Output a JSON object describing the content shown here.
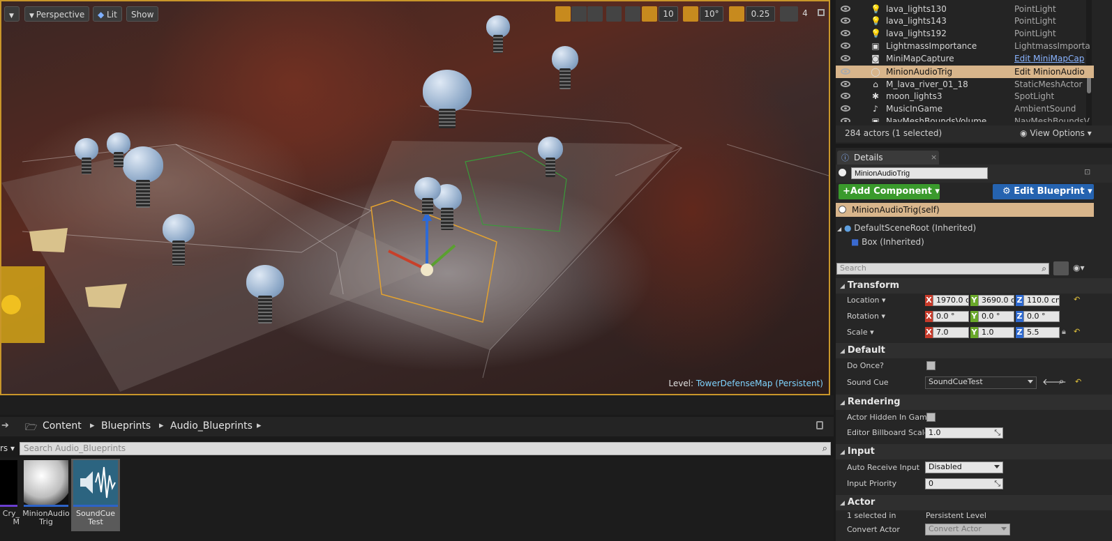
{
  "viewport": {
    "perspective_label": "Perspective",
    "lit_label": "Lit",
    "show_label": "Show",
    "grid_snap": "10",
    "rotation_snap": "10°",
    "scale_snap": "0.25",
    "camera_speed": "4",
    "level_prefix": "Level:",
    "level_name": "TowerDefenseMap (Persistent)"
  },
  "outliner": {
    "rows": [
      {
        "name": "lava_lights130",
        "type": "PointLight",
        "icon": "bulb-icon"
      },
      {
        "name": "lava_lights143",
        "type": "PointLight",
        "icon": "bulb-icon"
      },
      {
        "name": "lava_lights192",
        "type": "PointLight",
        "icon": "bulb-icon"
      },
      {
        "name": "LightmassImportance",
        "type": "LightmassImporta",
        "icon": "volume-icon"
      },
      {
        "name": "MiniMapCapture",
        "type": "Edit MiniMapCap",
        "icon": "camera-icon"
      },
      {
        "name": "MinionAudioTrig",
        "type": "Edit MinionAudio",
        "icon": "actor-icon"
      },
      {
        "name": "M_lava_river_01_18",
        "type": "StaticMeshActor",
        "icon": "mesh-icon"
      },
      {
        "name": "moon_lights3",
        "type": "SpotLight",
        "icon": "spotlight-icon"
      },
      {
        "name": "MusicInGame",
        "type": "AmbientSound",
        "icon": "sound-icon"
      },
      {
        "name": "NavMeshBoundsVolume",
        "type": "NavMeshBoundsV",
        "icon": "volume-icon"
      }
    ],
    "status": "284 actors (1 selected)",
    "view_options": "View Options"
  },
  "details": {
    "tab_label": "Details",
    "actor_name": "MinionAudioTrig",
    "add_component": "Add Component",
    "edit_blueprint": "Edit Blueprint",
    "self_label": "MinionAudioTrig(self)",
    "components": [
      "DefaultSceneRoot (Inherited)",
      "Box (Inherited)"
    ],
    "search_placeholder": "Search",
    "transform": {
      "title": "Transform",
      "location_label": "Location",
      "rotation_label": "Rotation",
      "scale_label": "Scale",
      "location": {
        "x": "1970.0 c",
        "y": "3690.0 c",
        "z": "110.0 cn"
      },
      "rotation": {
        "x": "0.0 °",
        "y": "0.0 °",
        "z": "0.0 °"
      },
      "scale": {
        "x": "7.0",
        "y": "1.0",
        "z": "5.5"
      }
    },
    "default": {
      "title": "Default",
      "do_once_label": "Do Once?",
      "sound_cue_label": "Sound Cue",
      "sound_cue_value": "SoundCueTest"
    },
    "rendering": {
      "title": "Rendering",
      "hidden_label": "Actor Hidden In Game",
      "billboard_label": "Editor Billboard Scale",
      "billboard_value": "1.0"
    },
    "input": {
      "title": "Input",
      "auto_receive_label": "Auto Receive Input",
      "auto_receive_value": "Disabled",
      "priority_label": "Input Priority",
      "priority_value": "0"
    },
    "actor": {
      "title": "Actor",
      "selected_in_label": "1 selected in",
      "selected_in_value": "Persistent Level",
      "convert_label": "Convert Actor",
      "convert_value": "Convert Actor"
    }
  },
  "content_browser": {
    "path": [
      "Content",
      "Blueprints",
      "Audio_Blueprints"
    ],
    "filters_label": "rs",
    "search_placeholder": "Search Audio_Blueprints",
    "assets": [
      {
        "label": "Cry_\nM"
      },
      {
        "label": "MinionAudio\nTrig"
      },
      {
        "label": "SoundCue\nTest"
      }
    ]
  },
  "colors": {
    "selection_border": "#c9962a",
    "outliner_selected": "#d8b58b",
    "add_component_green": "#3a9a2c",
    "edit_blueprint_blue": "#2563b0",
    "level_text": "#7fd4ff"
  }
}
